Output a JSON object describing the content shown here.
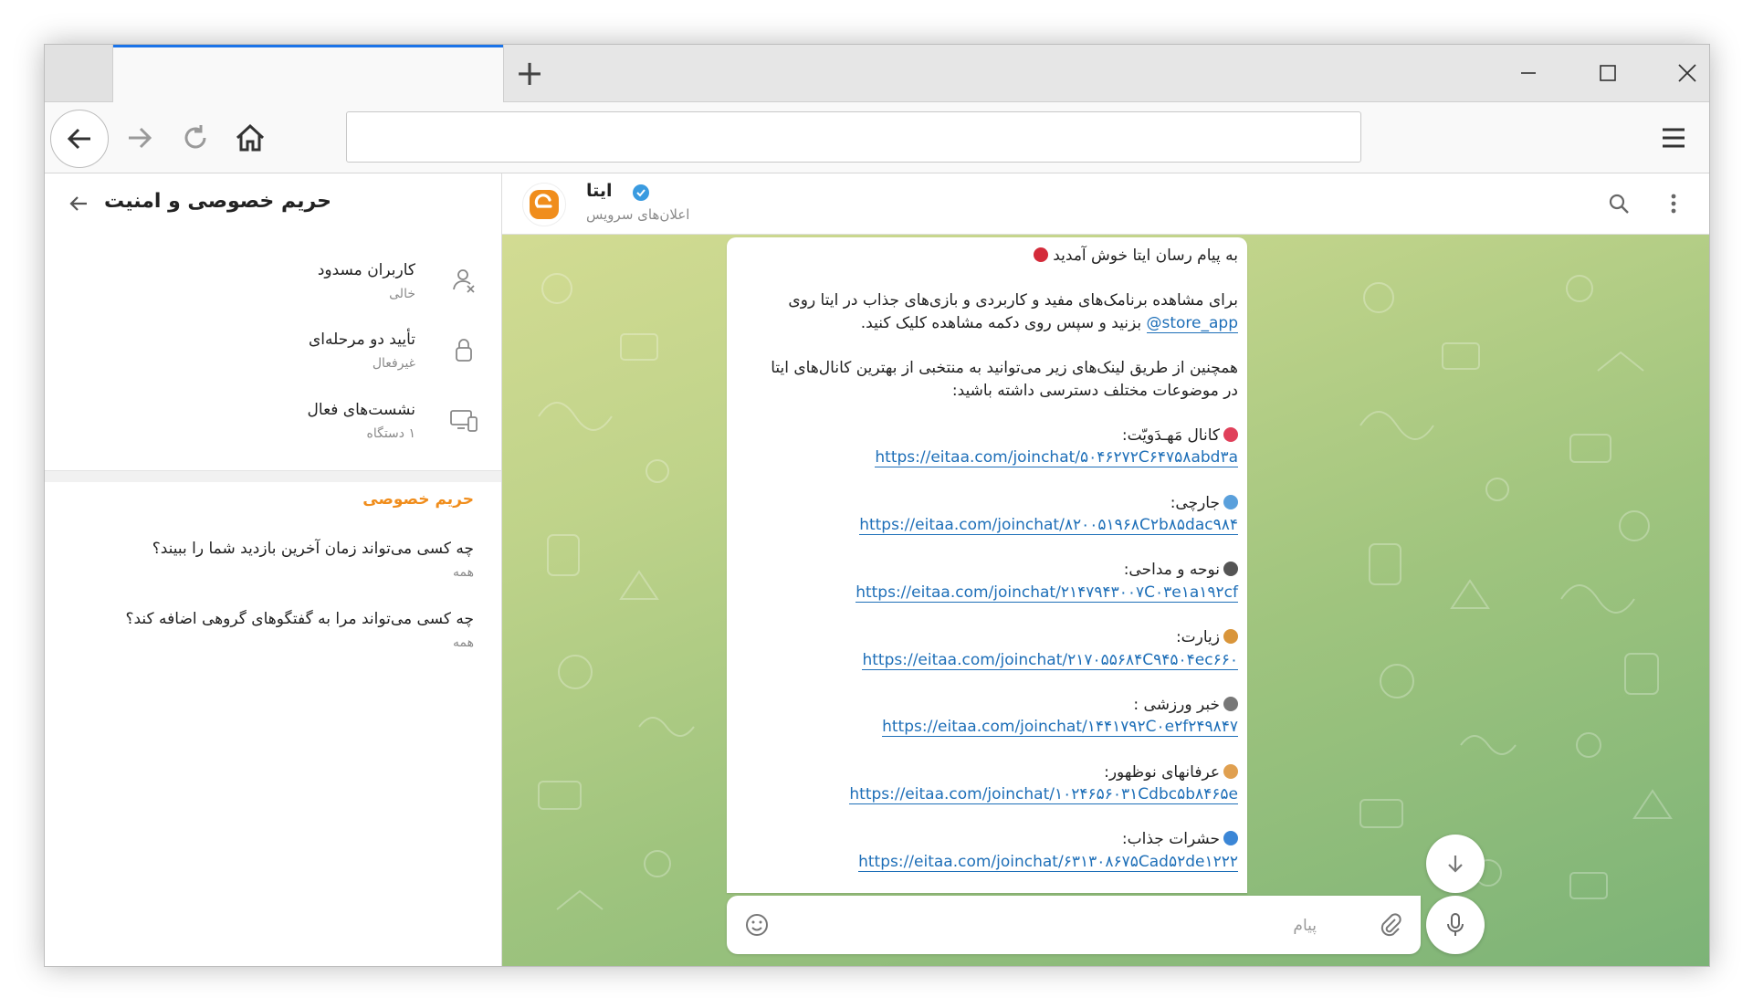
{
  "browser": {
    "new_tab_label": "+"
  },
  "sidebar": {
    "title": "حریم خصوصی و امنیت",
    "security_items": [
      {
        "label": "کاربران مسدود",
        "sub": "خالی",
        "icon": "blocked-user-icon"
      },
      {
        "label": "تأیید دو مرحله‌ای",
        "sub": "غیرفعال",
        "icon": "lock-icon"
      },
      {
        "label": "نشست‌های فعال",
        "sub": "۱ دستگاه",
        "icon": "devices-icon"
      }
    ],
    "privacy_header": "حریم خصوصی",
    "privacy_items": [
      {
        "label": "چه کسی می‌تواند زمان آخرین بازدید شما را ببیند؟",
        "sub": "همه"
      },
      {
        "label": "چه کسی می‌تواند مرا به گفتگوهای گروهی اضافه کند؟",
        "sub": "همه"
      }
    ]
  },
  "chat": {
    "name": "ایتا",
    "subtitle": "اعلان‌های سرویس",
    "message": {
      "greeting": "به پیام رسان ایتا خوش آمدید",
      "para1_line1": "برای مشاهده برنامک‌های مفید و کاربردی و بازی‌های جذاب در ایتا روی",
      "para1_line2_link": "@store_app",
      "para1_line2_rest": "بزنید و سپس روی دکمه مشاهده کلیک کنید.",
      "para2_line1": "همچنین از طریق لینک‌های زیر می‌توانید به منتخبی از بهترین کانال‌های ایتا",
      "para2_line2": "در موضوعات مختلف دسترسی داشته باشید:",
      "channels": [
        {
          "title": "کانال مَهـدَویّت:",
          "link": "https://eitaa.com/joinchat/۵۰۴۶۲۷۲C۶۴۷۵۸abd۳a",
          "emoji_color": "#e0405a"
        },
        {
          "title": "جارچی:",
          "link": "https://eitaa.com/joinchat/۸۲۰۰۵۱۹۶۸C۲b۸۵dac۹۸۴",
          "emoji_color": "#5aa0dc"
        },
        {
          "title": "نوحه و مداحی:",
          "link": "https://eitaa.com/joinchat/۲۱۴۷۹۴۳۰۰۷C۰۳e۱a۱۹۲cf",
          "emoji_color": "#555555"
        },
        {
          "title": "زیارت:",
          "link": "https://eitaa.com/joinchat/۲۱۷۰۵۵۶۸۴C۹۴۵۰۴ec۶۶۰",
          "emoji_color": "#d9953a"
        },
        {
          "title": "خبر ورزشی :",
          "link": "https://eitaa.com/joinchat/۱۴۴۱۷۹۲C۰e۲f۲۴۹۸۴۷",
          "emoji_color": "#777777"
        },
        {
          "title": "عرفانهای نوظهور:",
          "link": "https://eitaa.com/joinchat/۱۰۲۴۶۵۶۰۳۱Cdbc۵b۸۴۶۵e",
          "emoji_color": "#e0a050"
        },
        {
          "title": "حشرات جذاب:",
          "link": "https://eitaa.com/joinchat/۶۳۱۳۰۸۶۷۵Cad۵۲de۱۲۲۲",
          "emoji_color": "#3b86d6"
        }
      ]
    },
    "composer_placeholder": "پیام"
  },
  "colors": {
    "accent_orange": "#f08d1c",
    "link_blue": "#1e6fb8",
    "tab_indicator": "#1a73e8",
    "verified_blue": "#3a9be0"
  }
}
